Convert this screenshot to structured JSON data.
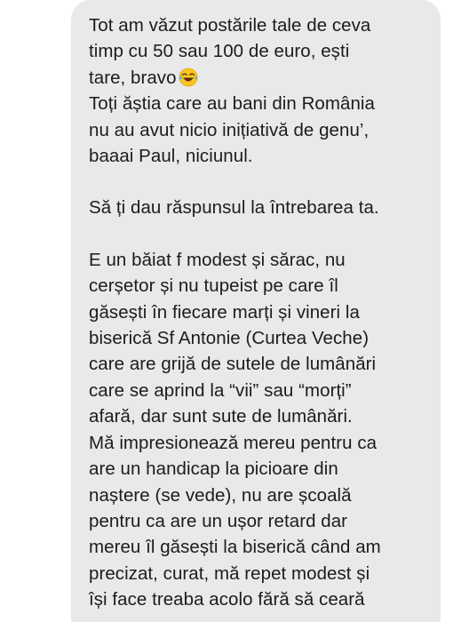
{
  "message": {
    "p1": "Tot am văzut postările tale de ceva\ntimp cu 50 sau 100 de euro, ești\ntare, bravo",
    "p1_emoji": "face-with-tears-of-joy-icon",
    "p2": "Toți ăștia care au bani din România\nnu au avut nicio inițiativă de genu’,\nbaaai Paul, niciunul.",
    "p3": "Să ți dau răspunsul la întrebarea ta.",
    "p4": "E un băiat f modest și sărac, nu\ncerșetor și nu tupeist pe care îl\ngăsești în fiecare marți și vineri la\nbiserică Sf Antonie (Curtea Veche)\ncare are grijă de sutele de lumânări\ncare se aprind la “vii” sau “morți”\nafară, dar sunt sute de lumânări.",
    "p5": "Mă impresionează mereu pentru ca\nare un handicap la picioare din\nnaștere (se vede), nu are școală\npentru ca are un ușor retard dar\nmereu îl găsești la biserică când am\nprecizat, curat, mă repet modest și\nîși face treaba acolo fără să ceară"
  },
  "colors": {
    "bubble": "#e9e9eb",
    "text": "#1c1c1e",
    "background": "#ffffff"
  }
}
